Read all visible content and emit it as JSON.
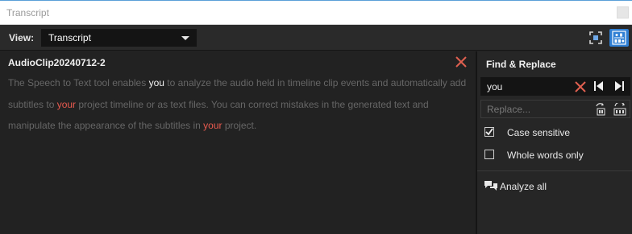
{
  "window": {
    "title": "Transcript"
  },
  "toolbar": {
    "view_label": "View:",
    "view_selected": "Transcript",
    "subtitles_button_active": true,
    "accent_color": "#2f7fd4"
  },
  "transcript": {
    "clip_title": "AudioClip20240712-2",
    "segments": [
      {
        "text": "The Speech to Text tool enables ",
        "style": "normal"
      },
      {
        "text": "you",
        "style": "highlight-current"
      },
      {
        "text": " to analyze the audio held in timeline clip events and automatically add subtitles to ",
        "style": "normal"
      },
      {
        "text": "your",
        "style": "highlight-match"
      },
      {
        "text": " project timeline or as text files. You can correct mistakes in the generated text and manipulate the appearance of the subtitles in ",
        "style": "normal"
      },
      {
        "text": "your",
        "style": "highlight-match"
      },
      {
        "text": " project.",
        "style": "normal"
      }
    ],
    "match_color": "#e85a4f"
  },
  "find_replace": {
    "title": "Find & Replace",
    "find_value": "you",
    "replace_placeholder": "Replace...",
    "case_sensitive_label": "Case sensitive",
    "case_sensitive_checked": true,
    "whole_words_label": "Whole words only",
    "whole_words_checked": false,
    "analyze_label": "Analyze all"
  }
}
